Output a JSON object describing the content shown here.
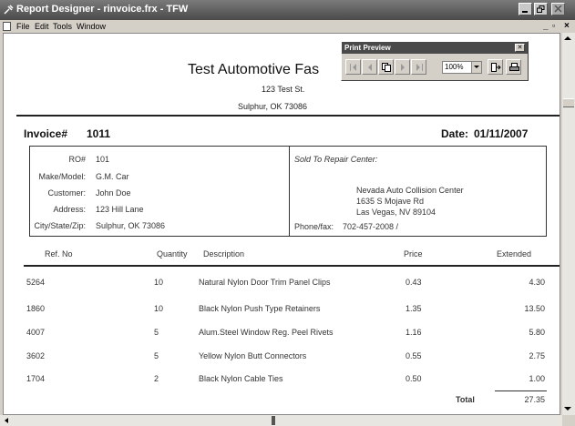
{
  "window": {
    "title": "Report Designer - rinvoice.frx - TFW"
  },
  "menu": {
    "items": [
      "File",
      "Edit",
      "Tools",
      "Window"
    ]
  },
  "preview_toolbar": {
    "title": "Print Preview",
    "zoom": "100%"
  },
  "report": {
    "company": "Test Automotive Fas",
    "address_line1": "123 Test St.",
    "address_line2": "Sulphur, OK 73086",
    "invoice_label": "Invoice#",
    "invoice_number": "1011",
    "date_label": "Date:",
    "date_value": "01/11/2007",
    "customer": {
      "ro_label": "RO#",
      "ro": "101",
      "make_label": "Make/Model:",
      "make": "G.M. Car",
      "customer_label": "Customer:",
      "customer": "John Doe",
      "address_label": "Address:",
      "address": "123 Hill Lane",
      "city_label": "City/State/Zip:",
      "city": "Sulphur, OK 73086"
    },
    "sold_to": {
      "label": "Sold To Repair Center:",
      "name": "Nevada Auto Collision Center",
      "street": "1635 S Mojave Rd",
      "city": "Las Vegas, NV 89104",
      "phone_label": "Phone/fax:",
      "phone": "702-457-2008 /"
    },
    "table": {
      "headers": {
        "ref": "Ref. No",
        "qty": "Quantity",
        "desc": "Description",
        "price": "Price",
        "ext": "Extended"
      },
      "rows": [
        {
          "ref": "5264",
          "qty": "10",
          "desc": "Natural Nylon Door Trim Panel Clips",
          "price": "0.43",
          "ext": "4.30"
        },
        {
          "ref": "1860",
          "qty": "10",
          "desc": "Black Nylon Push Type Retainers",
          "price": "1.35",
          "ext": "13.50"
        },
        {
          "ref": "4007",
          "qty": "5",
          "desc": "Alum.Steel Window Reg. Peel Rivets",
          "price": "1.16",
          "ext": "5.80"
        },
        {
          "ref": "3602",
          "qty": "5",
          "desc": "Yellow Nylon Butt Connectors",
          "price": "0.55",
          "ext": "2.75"
        },
        {
          "ref": "1704",
          "qty": "2",
          "desc": "Black Nylon Cable Ties",
          "price": "0.50",
          "ext": "1.00"
        }
      ],
      "total_label": "Total",
      "total": "27.35"
    }
  }
}
